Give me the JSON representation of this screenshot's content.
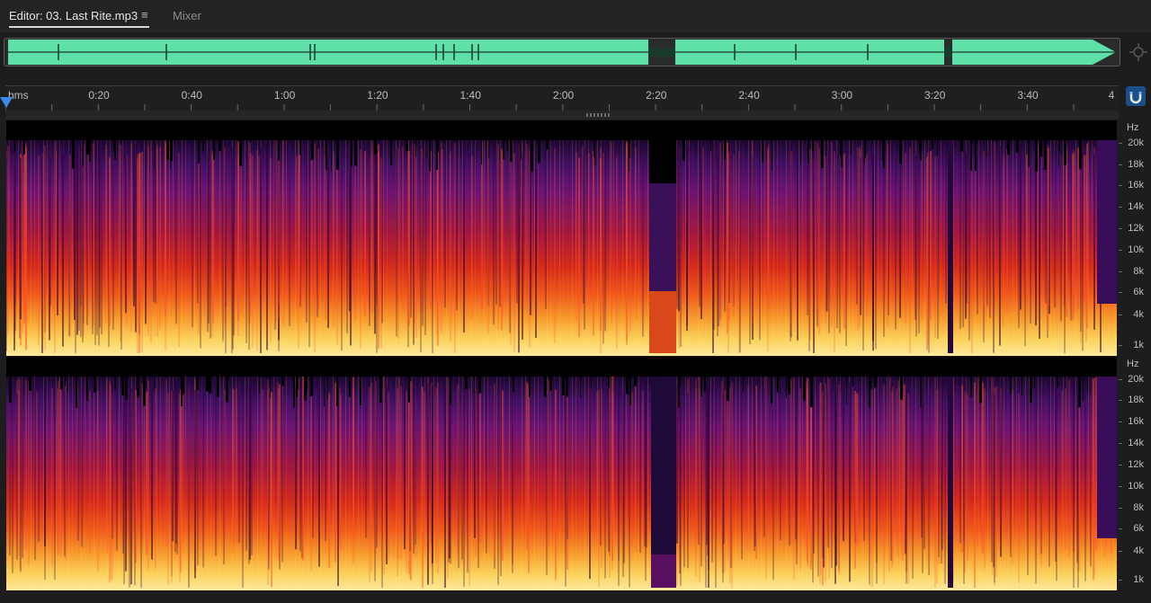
{
  "tabs": {
    "editor_label": "Editor: 03. Last Rite.mp3",
    "menu_glyph": "≡",
    "mixer_label": "Mixer"
  },
  "ruler": {
    "unit": "hms",
    "labels": [
      "0:20",
      "0:40",
      "1:00",
      "1:20",
      "1:40",
      "2:00",
      "2:20",
      "2:40",
      "3:00",
      "3:20",
      "3:40",
      "4"
    ]
  },
  "channels": [
    {
      "unit": "Hz",
      "labels": [
        "20k",
        "18k",
        "16k",
        "14k",
        "12k",
        "10k",
        "8k",
        "6k",
        "4k",
        "1k"
      ]
    },
    {
      "unit": "Hz",
      "labels": [
        "20k",
        "18k",
        "16k",
        "14k",
        "12k",
        "10k",
        "8k",
        "6k",
        "4k",
        "1k"
      ]
    }
  ],
  "icons": {
    "zoom": "zoom-navigator-icon",
    "snap": "snap-magnet-icon",
    "playhead": "playhead-marker-icon",
    "menu": "hamburger-menu-icon"
  },
  "colors": {
    "waveform": "#5fe0a8",
    "playhead": "#3b8cf0",
    "accent_button": "#1a4f8a"
  }
}
